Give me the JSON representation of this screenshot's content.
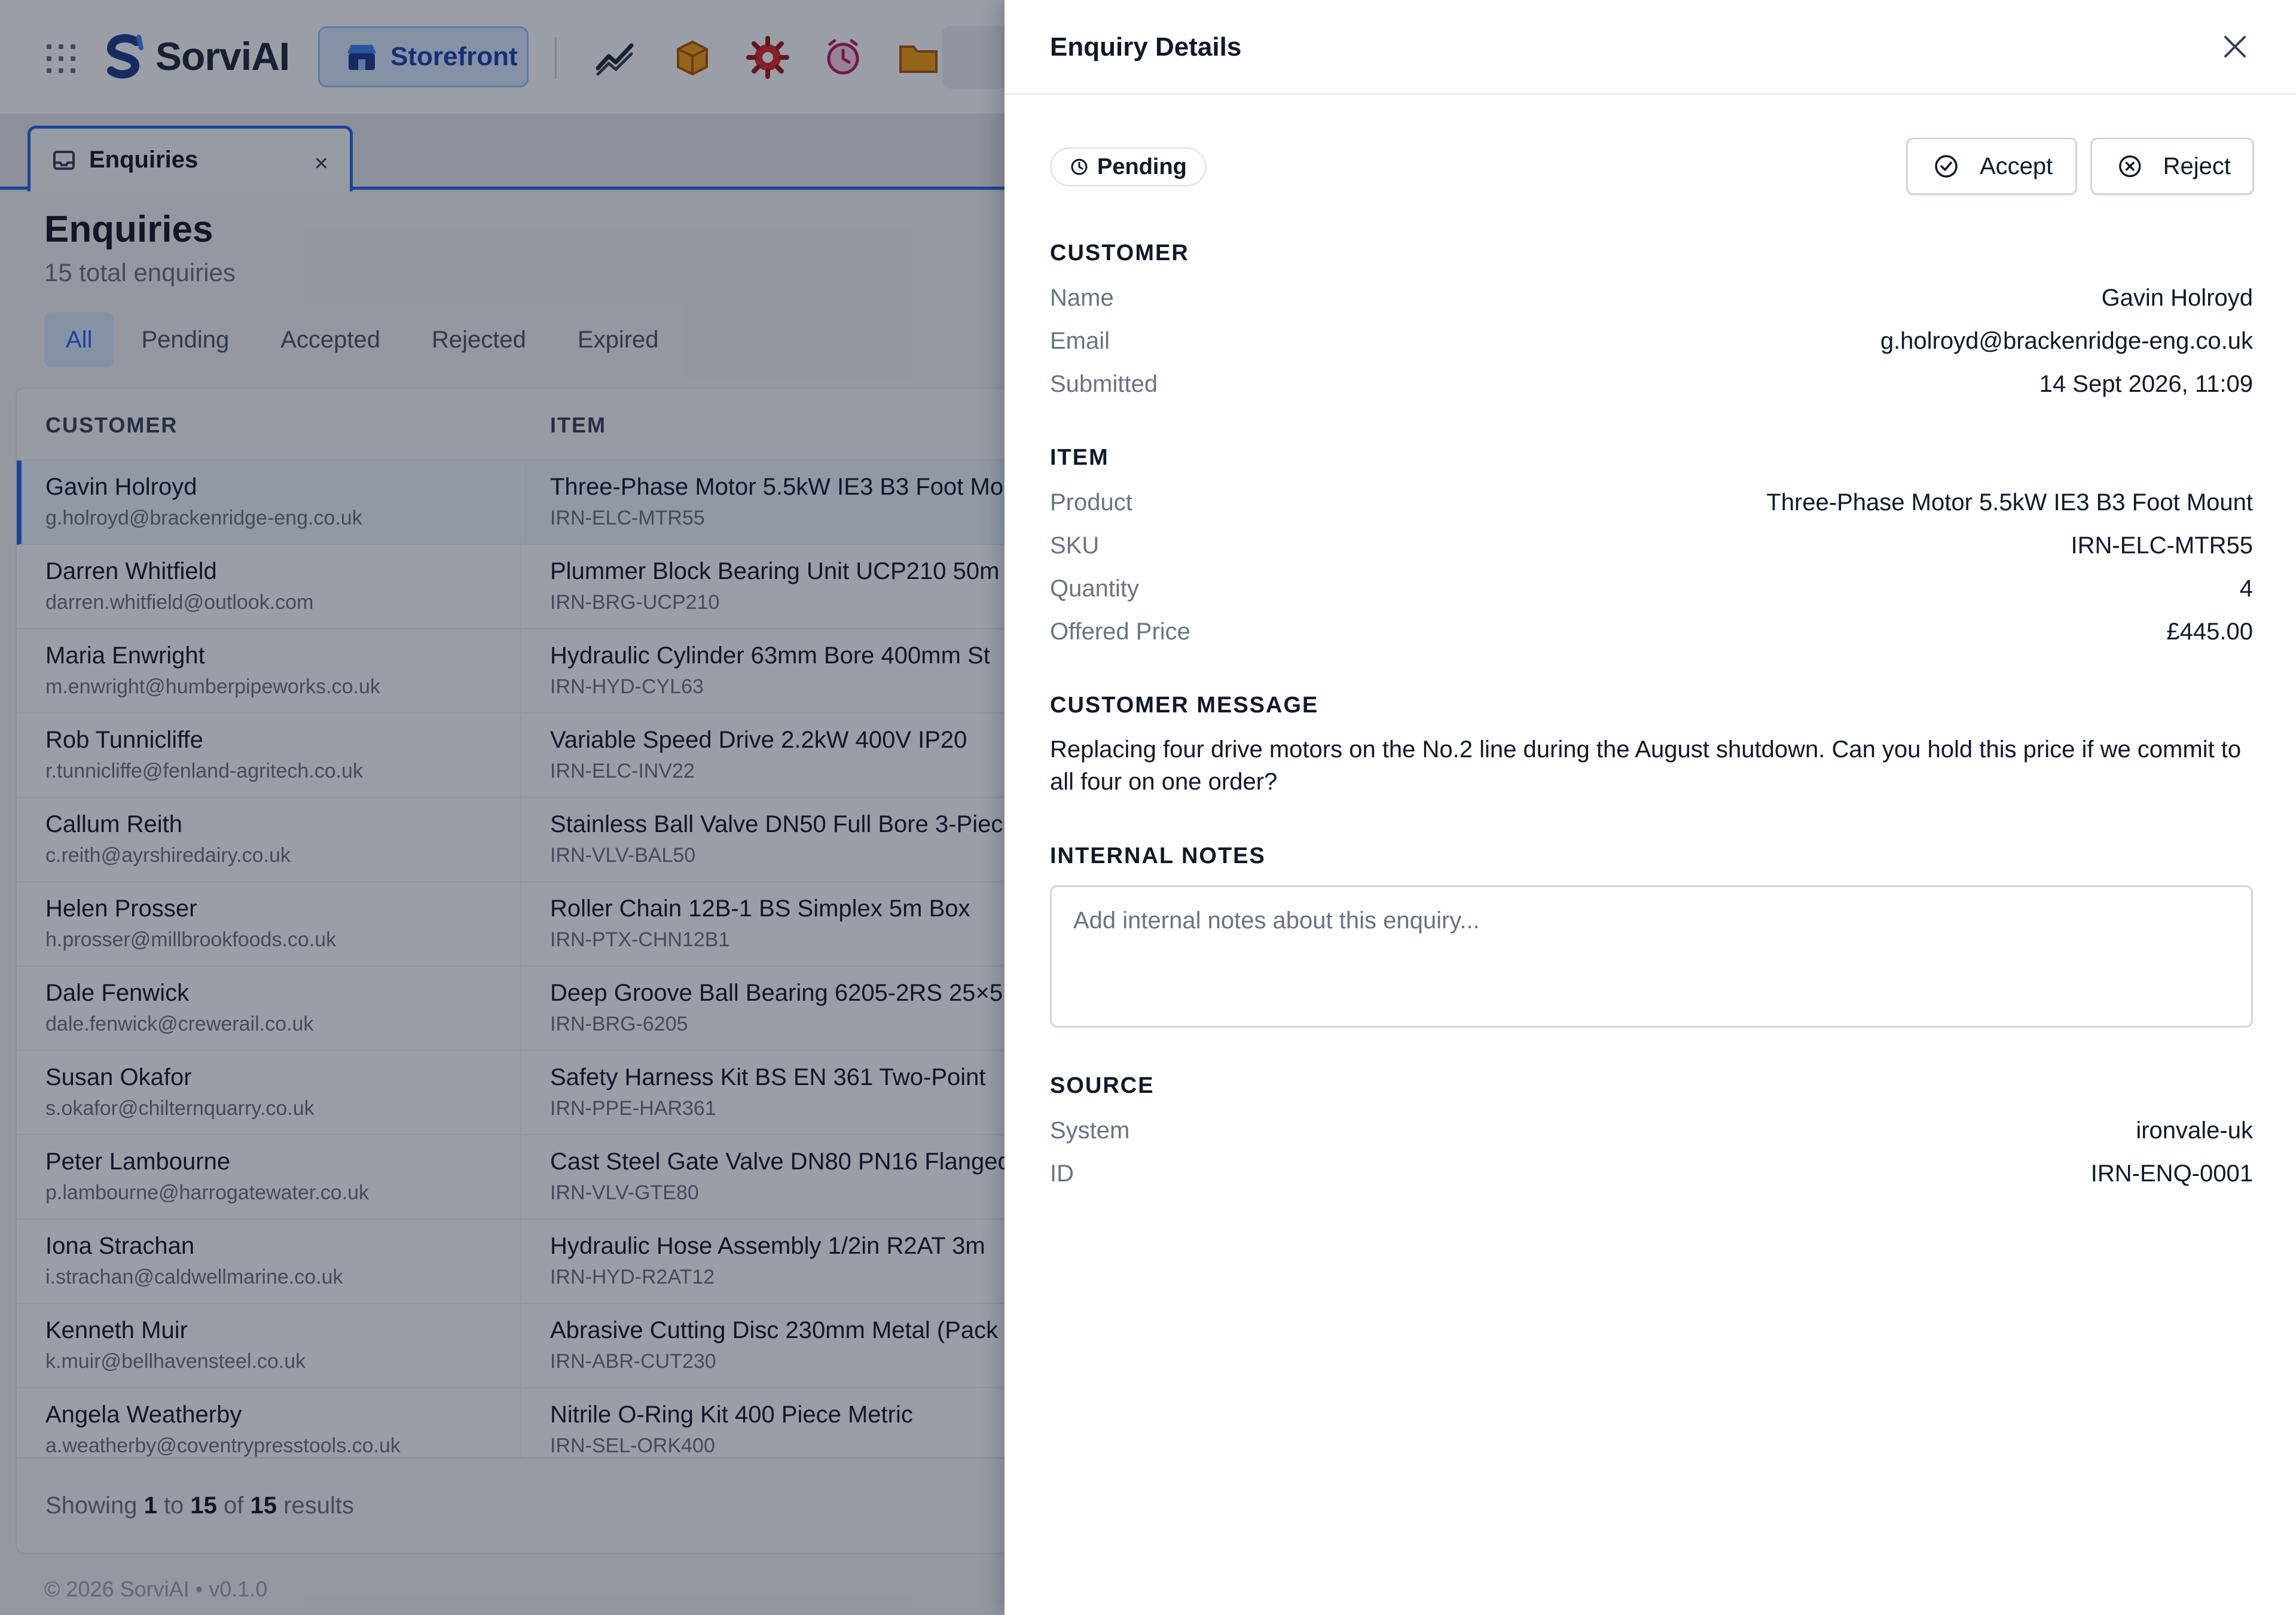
{
  "app": {
    "name": "SorviAI",
    "storefront_label": "Storefront",
    "tab_label": "Enquiries"
  },
  "page": {
    "title": "Enquiries",
    "subtitle": "15 total enquiries",
    "filters": [
      "All",
      "Pending",
      "Accepted",
      "Rejected",
      "Expired"
    ],
    "active_filter": "All"
  },
  "table": {
    "headers": [
      "CUSTOMER",
      "ITEM"
    ],
    "rows": [
      {
        "name": "Gavin Holroyd",
        "email": "g.holroyd@brackenridge-eng.co.uk",
        "item": "Three-Phase Motor 5.5kW IE3 B3 Foot Mo",
        "sku": "IRN-ELC-MTR55"
      },
      {
        "name": "Darren Whitfield",
        "email": "darren.whitfield@outlook.com",
        "item": "Plummer Block Bearing Unit UCP210 50m",
        "sku": "IRN-BRG-UCP210"
      },
      {
        "name": "Maria Enwright",
        "email": "m.enwright@humberpipeworks.co.uk",
        "item": "Hydraulic Cylinder 63mm Bore 400mm St",
        "sku": "IRN-HYD-CYL63"
      },
      {
        "name": "Rob Tunnicliffe",
        "email": "r.tunnicliffe@fenland-agritech.co.uk",
        "item": "Variable Speed Drive 2.2kW 400V IP20",
        "sku": "IRN-ELC-INV22"
      },
      {
        "name": "Callum Reith",
        "email": "c.reith@ayrshiredairy.co.uk",
        "item": "Stainless Ball Valve DN50 Full Bore 3-Piec",
        "sku": "IRN-VLV-BAL50"
      },
      {
        "name": "Helen Prosser",
        "email": "h.prosser@millbrookfoods.co.uk",
        "item": "Roller Chain 12B-1 BS Simplex 5m Box",
        "sku": "IRN-PTX-CHN12B1"
      },
      {
        "name": "Dale Fenwick",
        "email": "dale.fenwick@crewerail.co.uk",
        "item": "Deep Groove Ball Bearing 6205-2RS 25×5",
        "sku": "IRN-BRG-6205"
      },
      {
        "name": "Susan Okafor",
        "email": "s.okafor@chilternquarry.co.uk",
        "item": "Safety Harness Kit BS EN 361 Two-Point",
        "sku": "IRN-PPE-HAR361"
      },
      {
        "name": "Peter Lambourne",
        "email": "p.lambourne@harrogatewater.co.uk",
        "item": "Cast Steel Gate Valve DN80 PN16 Flanged",
        "sku": "IRN-VLV-GTE80"
      },
      {
        "name": "Iona Strachan",
        "email": "i.strachan@caldwellmarine.co.uk",
        "item": "Hydraulic Hose Assembly 1/2in R2AT 3m",
        "sku": "IRN-HYD-R2AT12"
      },
      {
        "name": "Kenneth Muir",
        "email": "k.muir@bellhavensteel.co.uk",
        "item": "Abrasive Cutting Disc 230mm Metal (Pack",
        "sku": "IRN-ABR-CUT230"
      },
      {
        "name": "Angela Weatherby",
        "email": "a.weatherby@coventrypresstools.co.uk",
        "item": "Nitrile O-Ring Kit 400 Piece Metric",
        "sku": "IRN-SEL-ORK400"
      }
    ],
    "footer": {
      "prefix": "Showing",
      "from": "1",
      "to_word": "to",
      "to": "15",
      "of_word": "of",
      "total": "15",
      "suffix": "results"
    }
  },
  "page_footer": "© 2026 SorviAI  •  v0.1.0",
  "drawer": {
    "title": "Enquiry Details",
    "status": "Pending",
    "accept_label": "Accept",
    "reject_label": "Reject",
    "customer": {
      "heading": "CUSTOMER",
      "name_label": "Name",
      "name": "Gavin Holroyd",
      "email_label": "Email",
      "email": "g.holroyd@brackenridge-eng.co.uk",
      "submitted_label": "Submitted",
      "submitted": "14 Sept 2026, 11:09"
    },
    "item": {
      "heading": "ITEM",
      "product_label": "Product",
      "product": "Three-Phase Motor 5.5kW IE3 B3 Foot Mount",
      "sku_label": "SKU",
      "sku": "IRN-ELC-MTR55",
      "quantity_label": "Quantity",
      "quantity": "4",
      "price_label": "Offered Price",
      "price": "£445.00"
    },
    "message": {
      "heading": "CUSTOMER MESSAGE",
      "text": "Replacing four drive motors on the No.2 line during the August shutdown. Can you hold this price if we commit to all four on one order?"
    },
    "notes": {
      "heading": "INTERNAL NOTES",
      "placeholder": "Add internal notes about this enquiry...",
      "value": ""
    },
    "source": {
      "heading": "SOURCE",
      "system_label": "System",
      "system": "ironvale-uk",
      "id_label": "ID",
      "id": "IRN-ENQ-0001"
    }
  },
  "colors": {
    "accent": "#2563eb",
    "overlay": "#0f172a"
  }
}
